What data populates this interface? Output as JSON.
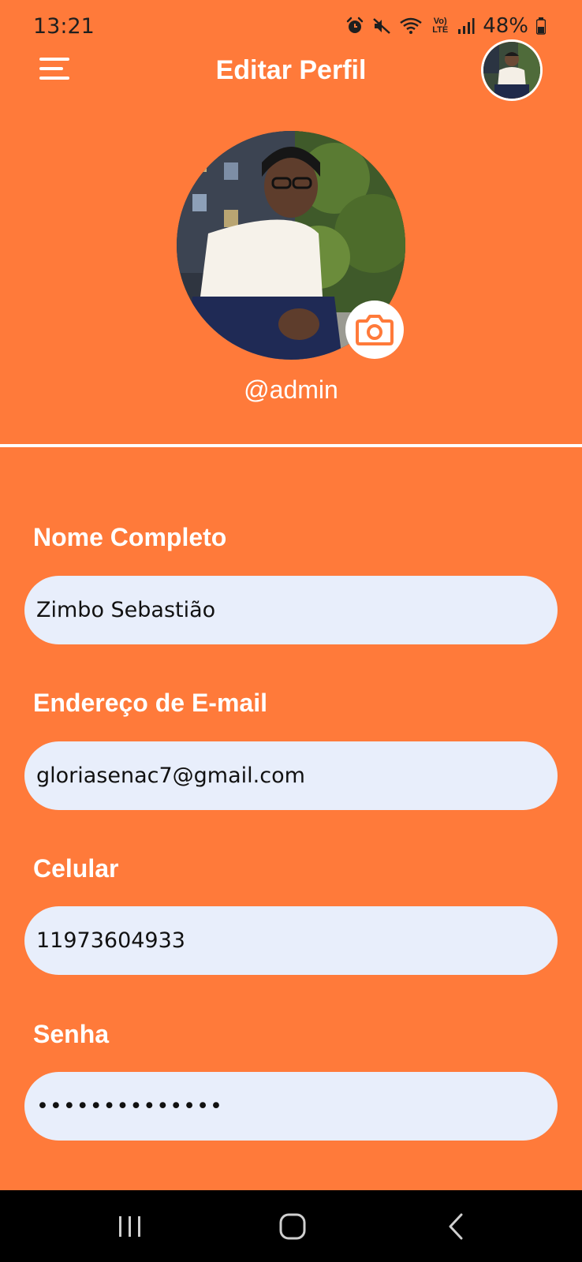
{
  "status_bar": {
    "time": "13:21",
    "battery": "48%",
    "network_badge": "Vo) LTE",
    "icons": [
      "alarm-icon",
      "mute-icon",
      "wifi-icon",
      "lte-icon",
      "signal-icon",
      "battery-icon"
    ]
  },
  "header": {
    "title": "Editar Perfil",
    "menu_icon": "hamburger-menu-icon"
  },
  "profile": {
    "username": "@admin",
    "camera_icon": "camera-icon"
  },
  "form": {
    "fields": [
      {
        "label": "Nome Completo",
        "value": "Zimbo Sebastião"
      },
      {
        "label": "Endereço de E-mail",
        "value": "gloriasenac7@gmail.com"
      },
      {
        "label": "Celular",
        "value": "11973604933"
      },
      {
        "label": "Senha",
        "value": "••••••••••••••"
      }
    ]
  },
  "nav_bar": {
    "icons": [
      "recent-apps-icon",
      "home-icon",
      "back-icon"
    ]
  },
  "colors": {
    "background": "#FF7A3A",
    "input_background": "#E8EEFB",
    "accent": "#FF7A3A"
  }
}
